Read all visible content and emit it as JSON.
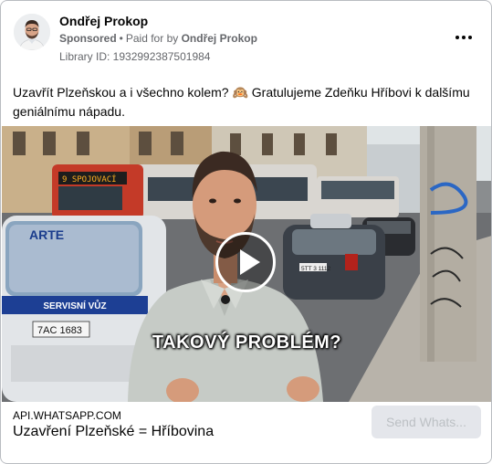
{
  "header": {
    "page_name": "Ondřej Prokop",
    "sponsored_label": "Sponsored",
    "separator": "•",
    "paid_for_prefix": "Paid for by",
    "paid_for_name": "Ondřej Prokop",
    "library_id": "Library ID: 1932992387501984",
    "more_icon": "more-horizontal-icon"
  },
  "post": {
    "text": "Uzavřít Plzeňskou a i všechno kolem? 🙉 Gratulujeme Zdeňku Hříbovi k dalšímu geniálnímu nápadu."
  },
  "video": {
    "caption": "TAKOVÝ PROBLÉM?",
    "tram_sign": "9 SPOJOVACÍ",
    "van_brand": "ARTE",
    "van_service": "SERVISNÍ VŮZ",
    "van_plate": "7AC 1683",
    "car_plate": "5TT 3 1112",
    "play_icon": "play-icon"
  },
  "link": {
    "domain": "API.WHATSAPP.COM",
    "title": "Uzavření Plzeňské = Hříbovina",
    "cta_label": "Send Whats..."
  },
  "colors": {
    "secondary_text": "#65676b",
    "cta_background": "#e4e6eb",
    "cta_text": "#bcc0c4",
    "border": "#b9bcc1"
  }
}
